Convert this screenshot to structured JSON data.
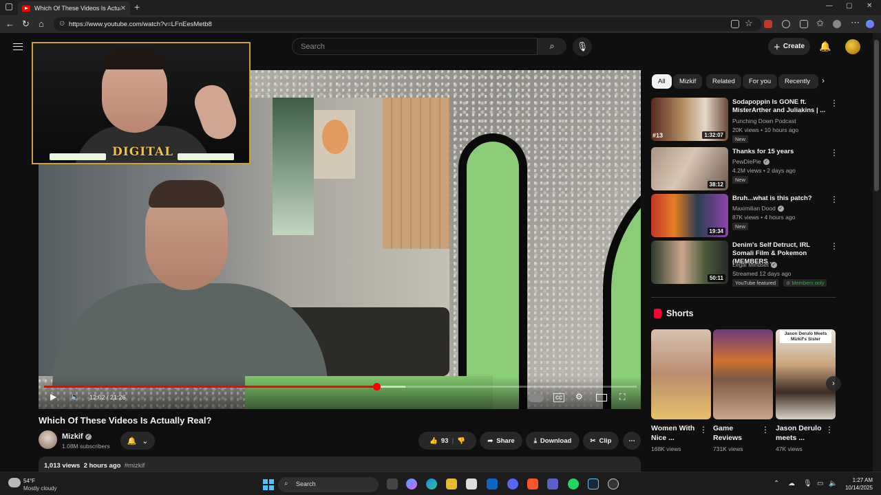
{
  "browser": {
    "tab_title": "Which Of These Videos Is Actually",
    "new_tab": "+",
    "url": "https://www.youtube.com/watch?v=LFnEesMetb8",
    "window_controls": [
      "—",
      "▢",
      "✕"
    ]
  },
  "youtube": {
    "search_placeholder": "Search",
    "create_label": "Create"
  },
  "player": {
    "time_current": "12:02",
    "time_total": "21:26",
    "time_display": "12:02 / 21:26",
    "progress_fraction": 0.561,
    "buffer_fraction": 0.61,
    "facecam_brand": "DIGITAL"
  },
  "video": {
    "title": "Which Of These Videos Is Actually Real?",
    "channel": "Mizkif",
    "subscribers": "1.08M subscribers",
    "likes": "93",
    "share_label": "Share",
    "download_label": "Download",
    "clip_label": "Clip",
    "views": "1,013 views",
    "posted": "2 hours ago",
    "hashtag": "#mizkif"
  },
  "chips": [
    "All",
    "Mizkif",
    "Related",
    "For you",
    "Recently"
  ],
  "recommendations": [
    {
      "title": "Sodapoppin Is GONE ft. MisterArther and Juliakins | ...",
      "channel": "Punching Down Podcast",
      "meta": "20K views • 10 hours ago",
      "duration": "1:32:07",
      "rank": "#13",
      "badge": "New",
      "verified": false
    },
    {
      "title": "Thanks for 15 years",
      "channel": "PewDiePie",
      "meta": "4.2M views • 2 days ago",
      "duration": "38:12",
      "badge": "New",
      "verified": true
    },
    {
      "title": "Bruh...what is this patch?",
      "channel": "Maximilian Dood",
      "meta": "87K views • 4 hours ago",
      "duration": "19:34",
      "badge": "New",
      "verified": true
    },
    {
      "title": "Denim's Self Detruct, IRL Somali Film & Pokemon (MEMBERS ...",
      "channel": "Legal Mindset",
      "meta": "Streamed 12 days ago",
      "duration": "50:11",
      "badge": "YouTube featured",
      "members": "Members only",
      "verified": true
    }
  ],
  "shorts": {
    "heading": "Shorts",
    "items": [
      {
        "title": "Women With Nice ...",
        "views": "168K views"
      },
      {
        "title": "Game Reviews",
        "views": "731K views"
      },
      {
        "title": "Jason Derulo meets ...",
        "views": "47K views",
        "overlay": "Jason Derulo Meets Mizkif's Sister"
      }
    ]
  },
  "taskbar": {
    "temperature": "54°F",
    "condition": "Mostly cloudy",
    "search_label": "Search",
    "time": "1:27 AM",
    "date": "10/14/2025"
  },
  "colors": {
    "youtube_red": "#ff0000",
    "accent_blue": "#4cc2ff",
    "member_green": "#2ba640"
  }
}
